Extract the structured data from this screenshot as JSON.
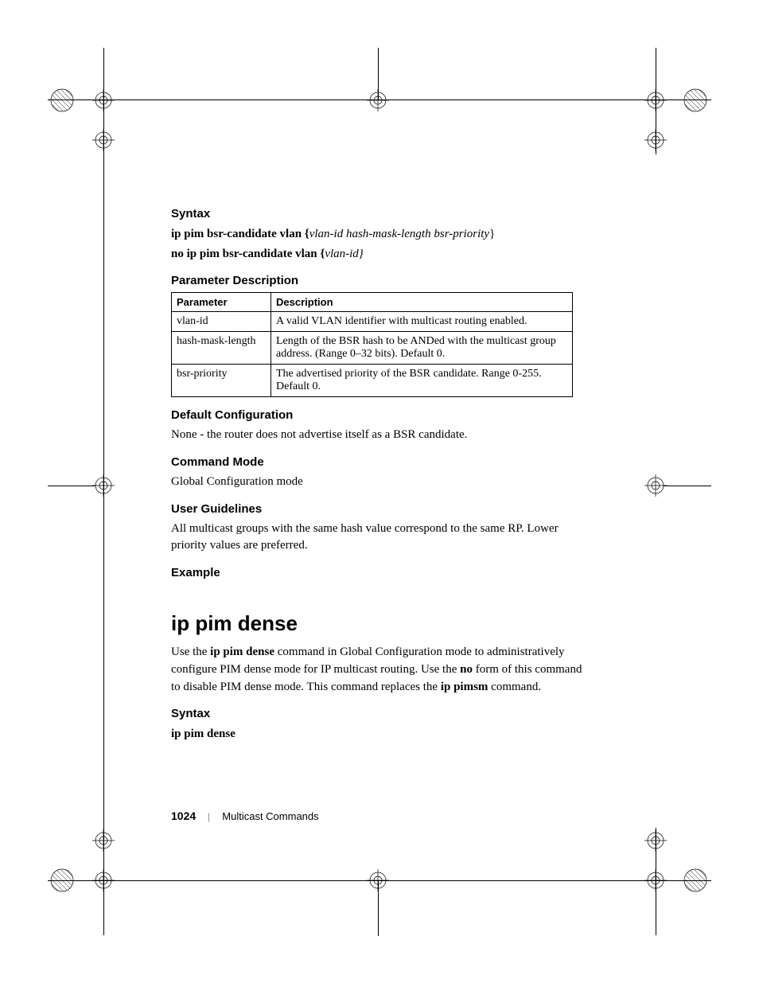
{
  "sections": {
    "syntax1_heading": "Syntax",
    "syntax1_line1_a": "ip pim bsr-candidate vlan {",
    "syntax1_line1_b": "vlan-id hash-mask-length bsr-priority",
    "syntax1_line1_c": "}",
    "syntax1_line2_a": "no ip pim bsr-candidate vlan {",
    "syntax1_line2_b": "vlan-id}",
    "param_heading": "Parameter Description",
    "table": {
      "h1": "Parameter",
      "h2": "Description",
      "rows": [
        {
          "p": "vlan-id",
          "d": "A valid VLAN identifier with multicast routing enabled."
        },
        {
          "p": "hash-mask-length",
          "d": "Length of the BSR hash to be ANDed with the multicast group address. (Range 0–32 bits). Default 0."
        },
        {
          "p": "bsr-priority",
          "d": "The advertised priority of the BSR candidate. Range 0-255. Default 0."
        }
      ]
    },
    "default_heading": "Default Configuration",
    "default_body": "None - the router does not advertise itself as a BSR candidate.",
    "mode_heading": "Command Mode",
    "mode_body": "Global Configuration mode",
    "guidelines_heading": "User Guidelines",
    "guidelines_body": "All multicast groups with the same hash value correspond to the same RP. Lower priority values are preferred.",
    "example_heading": "Example",
    "command_title": "ip pim dense",
    "dense_body_a": "Use the ",
    "dense_body_b": "ip pim dense",
    "dense_body_c": " command in Global Configuration mode to administratively configure PIM dense mode for IP multicast routing. Use the ",
    "dense_body_d": "no",
    "dense_body_e": " form of this command to disable PIM dense mode. This command replaces the ",
    "dense_body_f": "ip pimsm",
    "dense_body_g": " command.",
    "syntax2_heading": "Syntax",
    "syntax2_line1": "ip pim dense"
  },
  "footer": {
    "page": "1024",
    "chapter": "Multicast Commands"
  }
}
